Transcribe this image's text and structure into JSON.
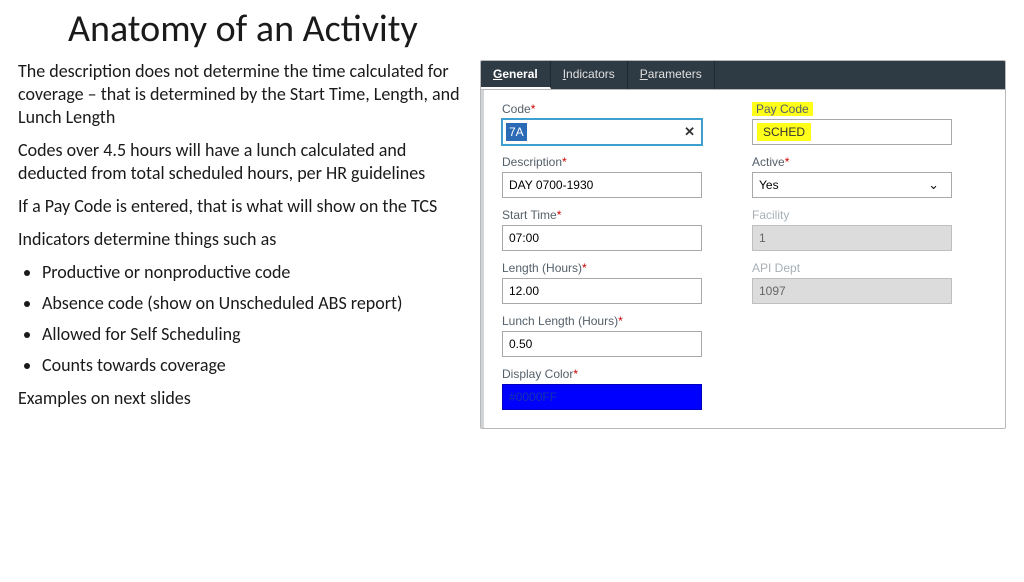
{
  "title": "Anatomy of an Activity",
  "left": {
    "p1": "The description does not determine the time calculated for coverage – that is determined by the Start Time, Length, and Lunch Length",
    "p2": "Codes over 4.5 hours will have a lunch calculated and deducted from total scheduled hours, per HR guidelines",
    "p3": "If a Pay Code is entered, that is what will show on the TCS",
    "p4": "Indicators determine things such as",
    "b1": "Productive or nonproductive code",
    "b2": "Absence code (show on Unscheduled ABS report)",
    "b3": "Allowed for Self Scheduling",
    "b4": "Counts towards coverage",
    "p5": "Examples on next slides"
  },
  "tabs": {
    "t1": "General",
    "t2": "Indicators",
    "t3": "Parameters"
  },
  "form": {
    "code_label": "Code",
    "code_val": "7A",
    "desc_label": "Description",
    "desc_val": "DAY 0700-1930",
    "start_label": "Start Time",
    "start_val": "07:00",
    "length_label": "Length (Hours)",
    "length_val": "12.00",
    "lunch_label": "Lunch Length (Hours)",
    "lunch_val": "0.50",
    "color_label": "Display Color",
    "color_val": "#0000FF",
    "paycode_label": "Pay Code",
    "paycode_val": "SCHED",
    "active_label": "Active",
    "active_val": "Yes",
    "facility_label": "Facility",
    "facility_val": "1",
    "dept_label": "API Dept",
    "dept_val": "1097"
  }
}
